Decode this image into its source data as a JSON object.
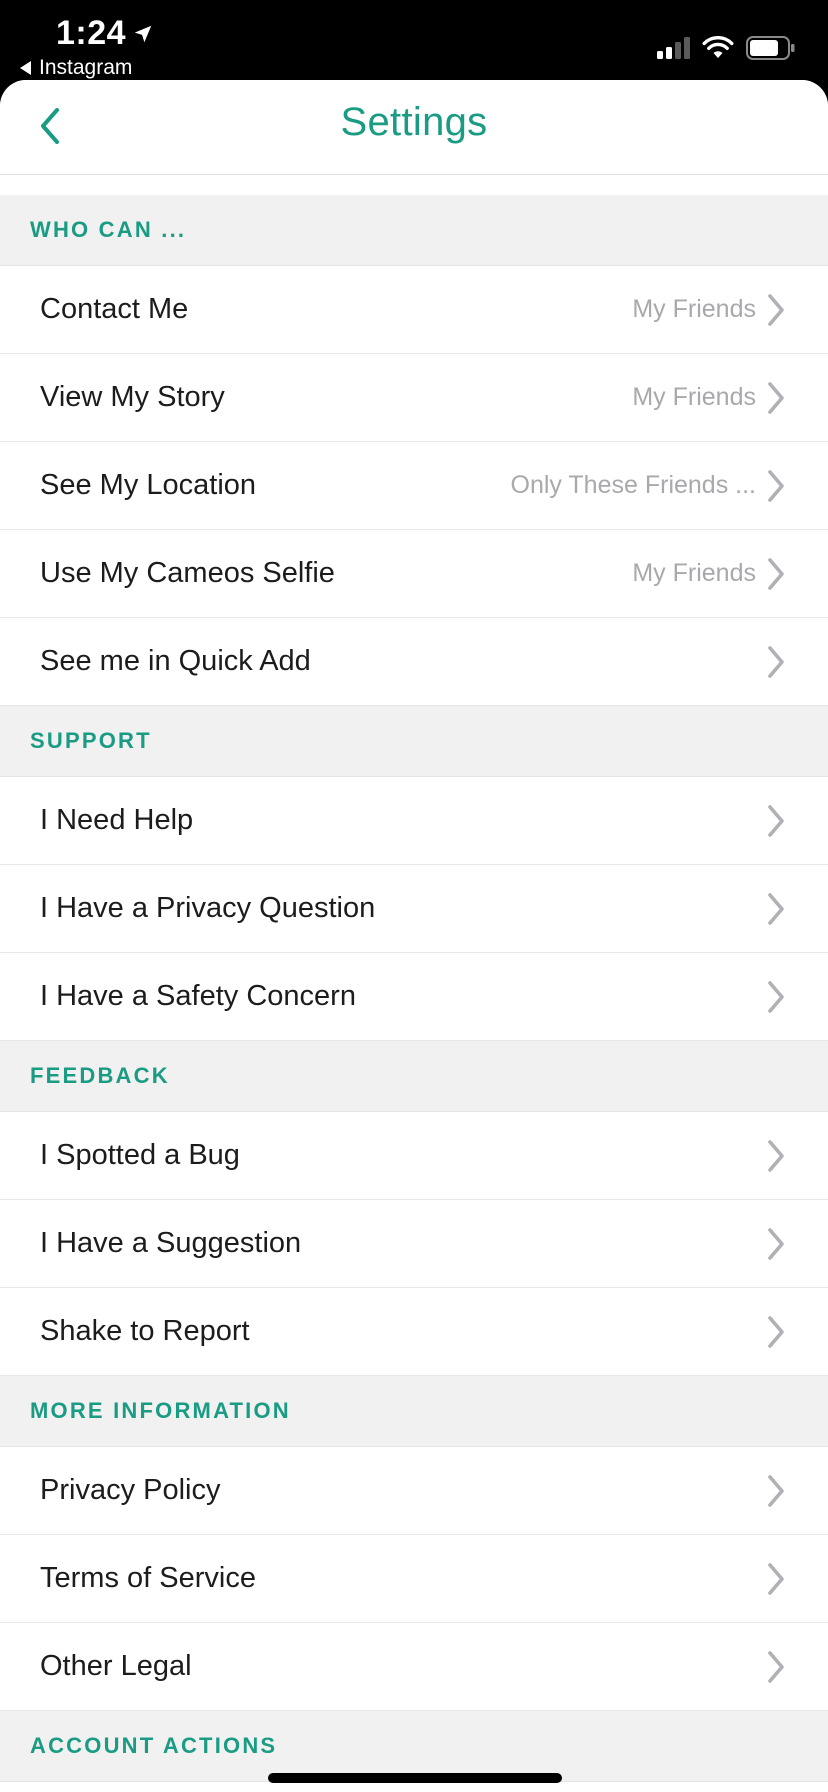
{
  "status_bar": {
    "time": "1:24",
    "back_app": "Instagram"
  },
  "nav": {
    "title": "Settings"
  },
  "colors": {
    "accent": "#1a9b83",
    "section_bg": "#f1f1f1",
    "value_text": "#a8a8ad"
  },
  "sections": [
    {
      "header": "WHO CAN ...",
      "rows": [
        {
          "label": "Contact Me",
          "value": "My Friends"
        },
        {
          "label": "View My Story",
          "value": "My Friends"
        },
        {
          "label": "See My Location",
          "value": "Only These Friends ..."
        },
        {
          "label": "Use My Cameos Selfie",
          "value": "My Friends"
        },
        {
          "label": "See me in Quick Add",
          "value": ""
        }
      ]
    },
    {
      "header": "SUPPORT",
      "rows": [
        {
          "label": "I Need Help",
          "value": ""
        },
        {
          "label": "I Have a Privacy Question",
          "value": ""
        },
        {
          "label": "I Have a Safety Concern",
          "value": ""
        }
      ]
    },
    {
      "header": "FEEDBACK",
      "rows": [
        {
          "label": "I Spotted a Bug",
          "value": ""
        },
        {
          "label": "I Have a Suggestion",
          "value": ""
        },
        {
          "label": "Shake to Report",
          "value": ""
        }
      ]
    },
    {
      "header": "MORE INFORMATION",
      "rows": [
        {
          "label": "Privacy Policy",
          "value": ""
        },
        {
          "label": "Terms of Service",
          "value": ""
        },
        {
          "label": "Other Legal",
          "value": ""
        }
      ]
    },
    {
      "header": "ACCOUNT ACTIONS",
      "rows": []
    }
  ],
  "icons": {
    "back": "chevron-left-icon",
    "row": "chevron-right-icon",
    "location": "location-arrow-icon",
    "signal": "cellular-signal-icon",
    "wifi": "wifi-icon",
    "battery": "battery-icon"
  }
}
